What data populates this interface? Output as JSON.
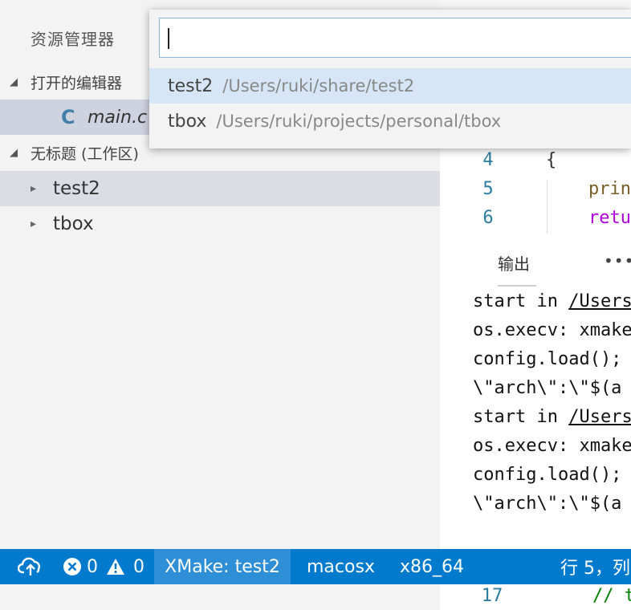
{
  "sidebar": {
    "title": "资源管理器",
    "open_editors_label": "打开的编辑器",
    "open_file_icon": "C",
    "open_file_name": "main.c",
    "workspace_label": "无标题 (工作区)",
    "folders": [
      {
        "name": "test2"
      },
      {
        "name": "tbox"
      }
    ]
  },
  "quick_pick": {
    "input_value": "",
    "items": [
      {
        "label": "test2",
        "path": "/Users/ruki/share/test2"
      },
      {
        "label": "tbox",
        "path": "/Users/ruki/projects/personal/tbox"
      }
    ]
  },
  "editor": {
    "lines": [
      {
        "num": "4",
        "text": "{"
      },
      {
        "num": "5",
        "text": "    printf"
      },
      {
        "num": "6",
        "text": "    return"
      }
    ],
    "bottom_line": {
      "num": "17",
      "text": "// t"
    }
  },
  "panel": {
    "tab_label": "输出",
    "more_label": "•••",
    "output_lines": [
      {
        "prefix": "start in ",
        "link": "/Users"
      },
      {
        "prefix": "os.execv: xmake",
        "link": ""
      },
      {
        "prefix": "config.load();",
        "link": ""
      },
      {
        "prefix": "\\\"arch\\\":\\\"$(a",
        "link": ""
      },
      {
        "prefix": "start in ",
        "link": "/Users"
      },
      {
        "prefix": "os.execv: xmake",
        "link": ""
      },
      {
        "prefix": "config.load();",
        "link": ""
      },
      {
        "prefix": "\\\"arch\\\":\\\"$(a",
        "link": ""
      }
    ]
  },
  "statusbar": {
    "errors": "0",
    "warnings": "0",
    "xmake": "XMake: test2",
    "platform": "macosx",
    "arch": "x86_64",
    "position": "行 5，列"
  },
  "colors": {
    "statusbar_bg": "#007acc",
    "xmake_bg": "#2e8ed6",
    "selection": "#d6e6f6",
    "c_icon": "#3f7fa8"
  }
}
